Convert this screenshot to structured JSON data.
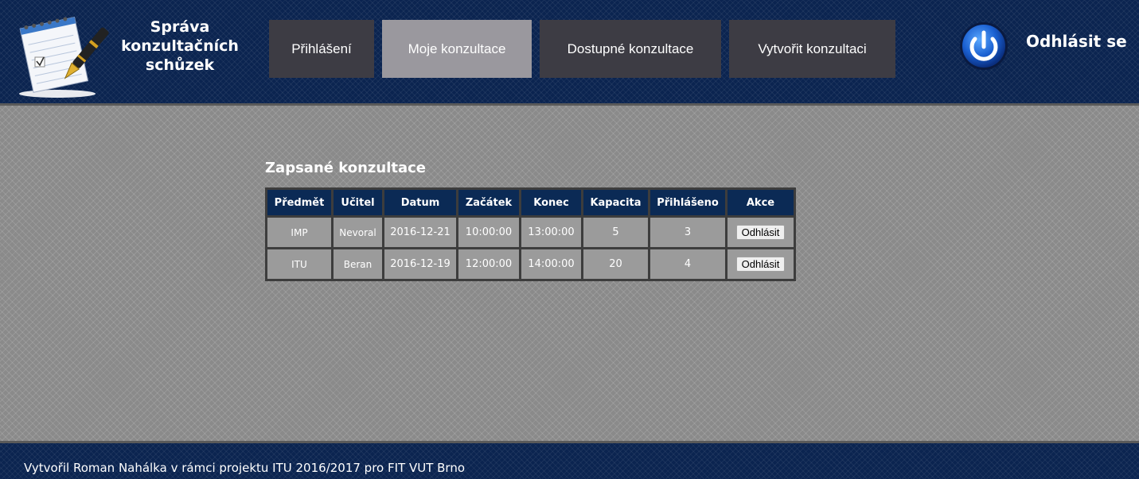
{
  "header": {
    "title_line1": "Správa",
    "title_line2": "konzultačních",
    "title_line3": "schůzek"
  },
  "nav": {
    "items": [
      {
        "label": "Přihlášení",
        "active": false
      },
      {
        "label": "Moje konzultace",
        "active": true
      },
      {
        "label": "Dostupné konzultace",
        "active": false
      },
      {
        "label": "Vytvořit konzultaci",
        "active": false
      }
    ],
    "logout_label": "Odhlásit se"
  },
  "main": {
    "section_title": "Zapsané konzultace",
    "table": {
      "headers": [
        "Předmět",
        "Učitel",
        "Datum",
        "Začátek",
        "Konec",
        "Kapacita",
        "Přihlášeno",
        "Akce"
      ],
      "rows": [
        {
          "predmet": "IMP",
          "ucitel": "Nevoral",
          "datum": "2016-12-21",
          "zacatek": "10:00:00",
          "konec": "13:00:00",
          "kapacita": "5",
          "prihlaseno": "3",
          "akce": "Odhlásit"
        },
        {
          "predmet": "ITU",
          "ucitel": "Beran",
          "datum": "2016-12-19",
          "zacatek": "12:00:00",
          "konec": "14:00:00",
          "kapacita": "20",
          "prihlaseno": "4",
          "akce": "Odhlásit"
        }
      ]
    }
  },
  "footer": {
    "text": "Vytvořil Roman Nahálka v rámci projektu ITU 2016/2017 pro FIT VUT Brno"
  },
  "colors": {
    "header_bg": "#0b2450",
    "nav_bg": "#3d3c44",
    "nav_active_bg": "#9a989e",
    "table_header_bg": "#0b2a55",
    "table_cell_bg": "#9b9b9b"
  },
  "icons": {
    "logo": "notepad-pen-icon",
    "logout": "power-icon"
  }
}
